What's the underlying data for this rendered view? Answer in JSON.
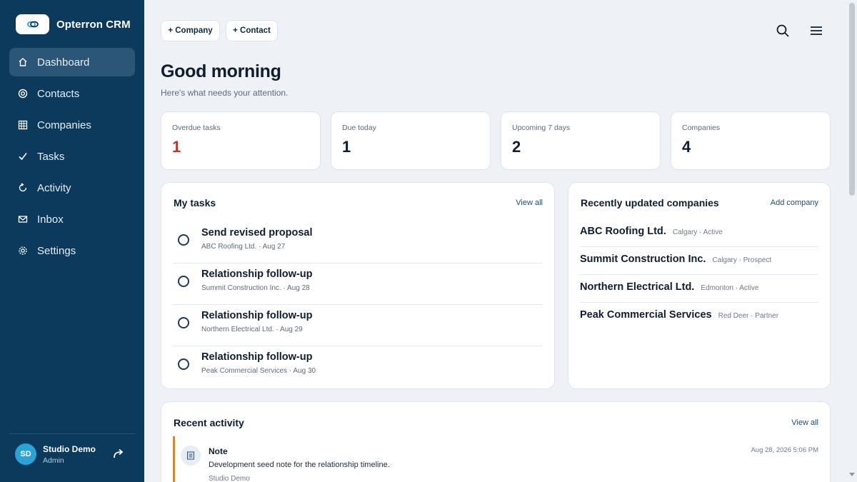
{
  "app": {
    "title": "Opterron CRM"
  },
  "sidebar": {
    "items": [
      {
        "label": "Dashboard",
        "icon": "home-icon",
        "active": true
      },
      {
        "label": "Contacts",
        "icon": "contacts-icon",
        "active": false
      },
      {
        "label": "Companies",
        "icon": "grid-icon",
        "active": false
      },
      {
        "label": "Tasks",
        "icon": "check-icon",
        "active": false
      },
      {
        "label": "Activity",
        "icon": "refresh-icon",
        "active": false
      },
      {
        "label": "Inbox",
        "icon": "mail-icon",
        "active": false
      },
      {
        "label": "Settings",
        "icon": "gear-icon",
        "active": false
      }
    ],
    "user": {
      "initials": "SD",
      "name": "Studio Demo",
      "role": "Admin"
    }
  },
  "toolbar": {
    "add_company": "+ Company",
    "add_contact": "+ Contact"
  },
  "header": {
    "greeting": "Good morning",
    "subtitle": "Here's what needs your attention."
  },
  "stats": [
    {
      "label": "Overdue tasks",
      "value": "1"
    },
    {
      "label": "Due today",
      "value": "1"
    },
    {
      "label": "Upcoming 7 days",
      "value": "2"
    },
    {
      "label": "Companies",
      "value": "4"
    }
  ],
  "my_tasks": {
    "title": "My tasks",
    "link": "View all",
    "items": [
      {
        "title": "Send revised proposal",
        "meta": "ABC Roofing Ltd. · Aug 27"
      },
      {
        "title": "Relationship follow-up",
        "meta": "Summit Construction Inc. · Aug 28"
      },
      {
        "title": "Relationship follow-up",
        "meta": "Northern Electrical Ltd. · Aug 29"
      },
      {
        "title": "Relationship follow-up",
        "meta": "Peak Commercial Services · Aug 30"
      }
    ]
  },
  "companies": {
    "title": "Recently updated companies",
    "link": "Add company",
    "items": [
      {
        "name": "ABC Roofing Ltd.",
        "meta": "Calgary · Active"
      },
      {
        "name": "Summit Construction Inc.",
        "meta": "Calgary · Prospect"
      },
      {
        "name": "Northern Electrical Ltd.",
        "meta": "Edmonton · Active"
      },
      {
        "name": "Peak Commercial Services",
        "meta": "Red Deer · Partner"
      }
    ]
  },
  "activity": {
    "title": "Recent activity",
    "link": "View all",
    "items": [
      {
        "type": "Note",
        "description": "Development seed note for the relationship timeline.",
        "author": "Studio Demo",
        "time": "Aug 28, 2026 5:06 PM"
      }
    ]
  },
  "colors": {
    "sidebar_bg": "#0b3a5c",
    "active_nav": "#2b5677",
    "danger": "#b03a3a",
    "accent_bar": "#c98a3a",
    "avatar": "#2aa3d6"
  }
}
